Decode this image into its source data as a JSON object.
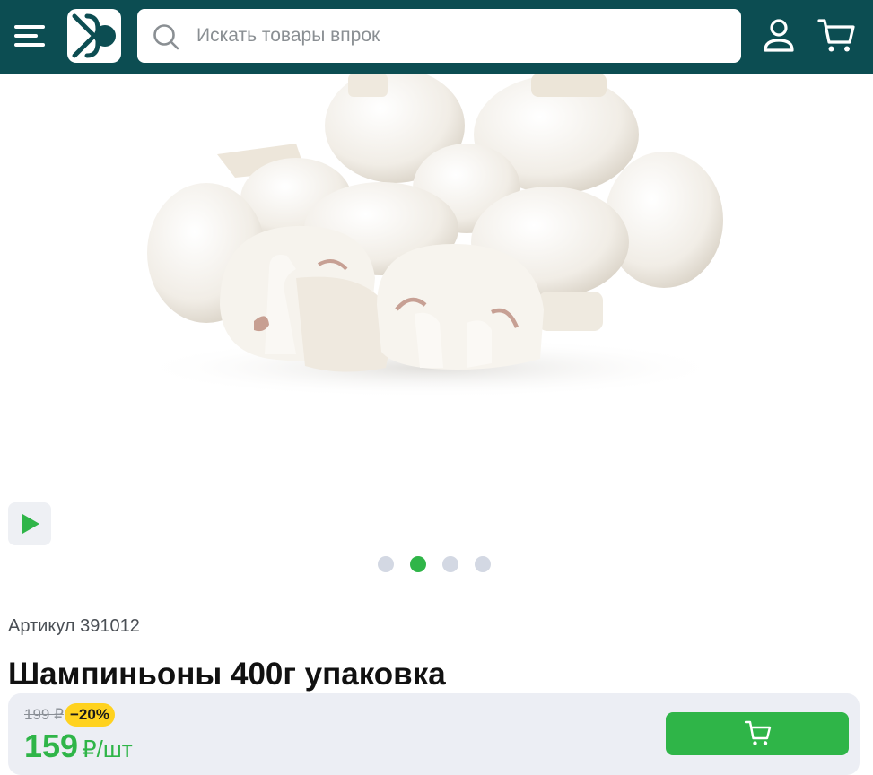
{
  "header": {
    "menu_icon": "hamburger-menu-icon",
    "logo_icon": "store-logo",
    "search": {
      "placeholder": "Искать товары впрок",
      "value": "",
      "icon": "search-icon"
    },
    "profile_icon": "user-icon",
    "cart_icon": "cart-icon",
    "background_color": "#0c4d52"
  },
  "gallery": {
    "image_subject": "mushrooms",
    "play_icon": "play-icon",
    "slides_count": 4,
    "active_slide": 2
  },
  "product": {
    "sku_label": "Артикул 391012",
    "title": "Шампиньоны 400г упаковка",
    "old_price": "199 ₽",
    "discount": "−20%",
    "price": "159",
    "price_unit": "₽/шт",
    "cart_button_icon": "cart-icon"
  },
  "colors": {
    "accent_green": "#2fb548",
    "discount_yellow": "#ffd21f",
    "header_teal": "#0c4d52"
  }
}
